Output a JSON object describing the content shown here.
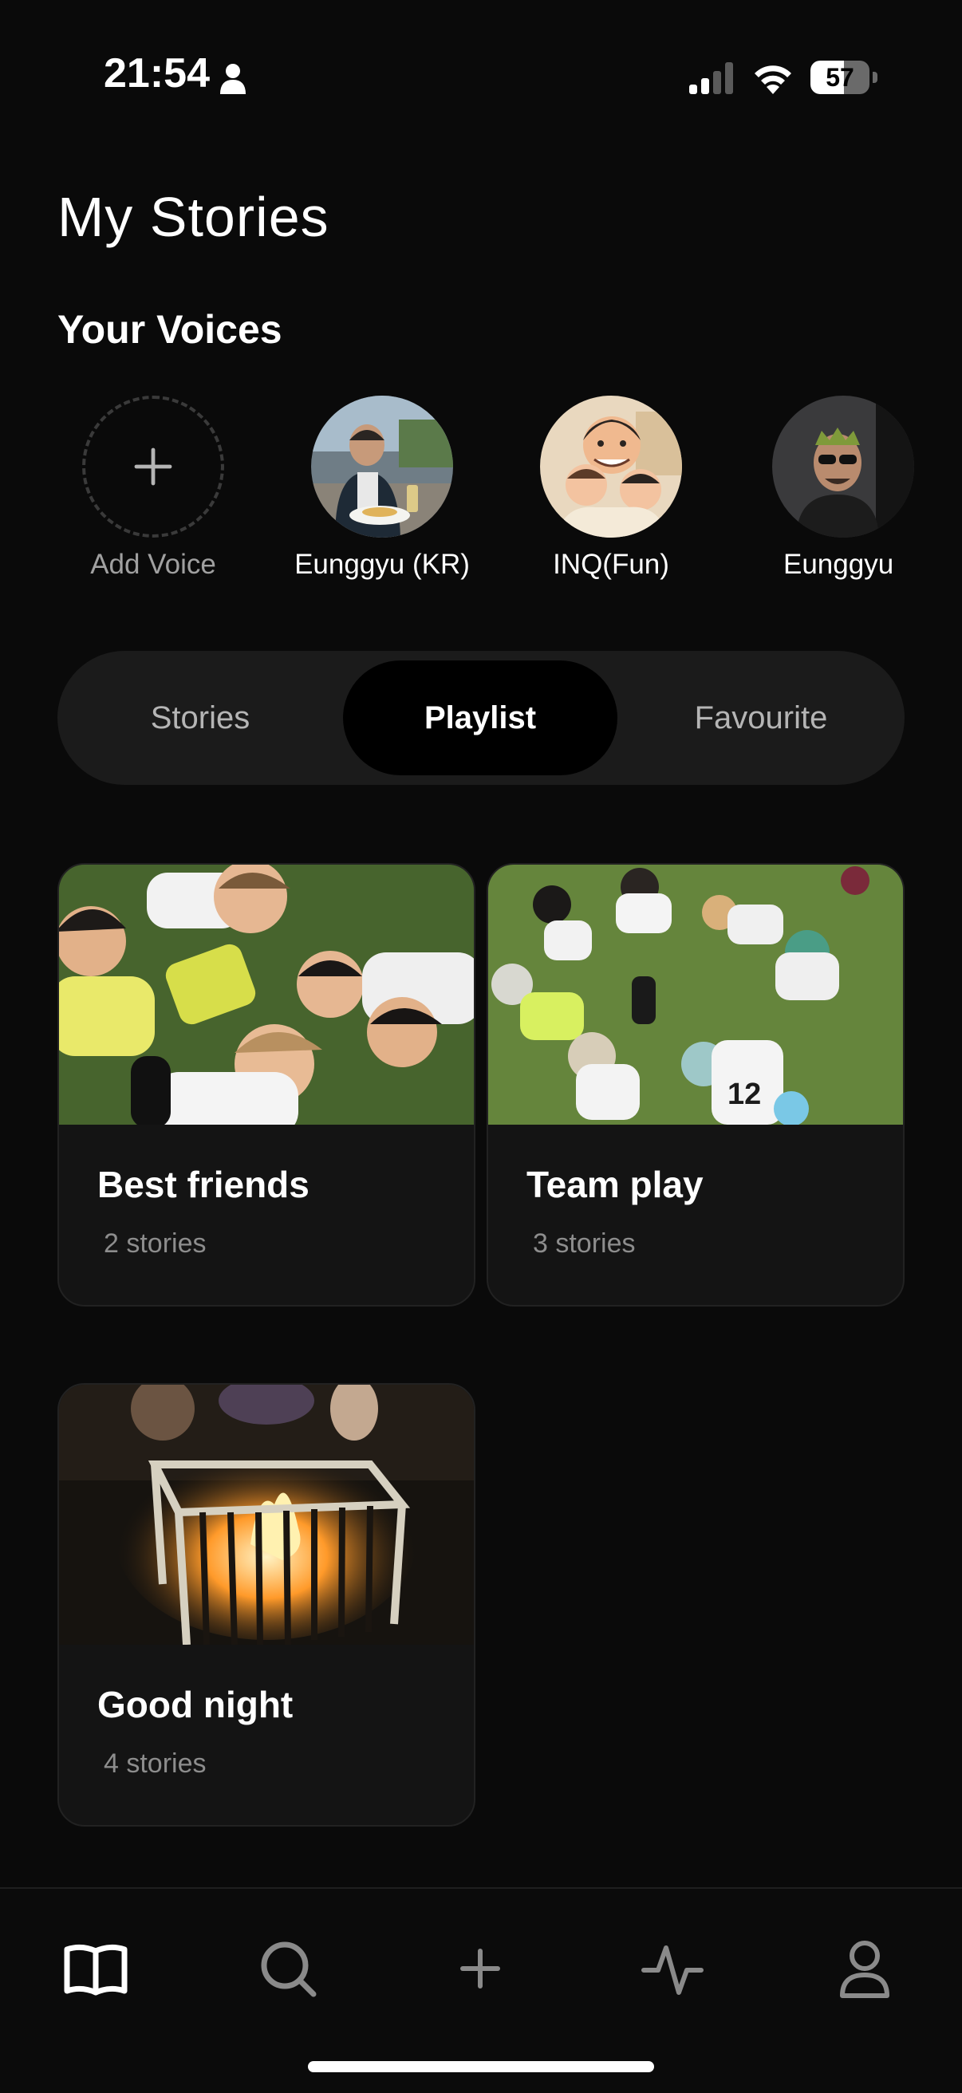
{
  "status_bar": {
    "time": "21:54",
    "battery_percent": 57,
    "battery_label": "57",
    "signal_bars_active": 2,
    "signal_bars_total": 4
  },
  "page": {
    "title": "My Stories"
  },
  "voices_section": {
    "title": "Your Voices",
    "add_label": "Add Voice",
    "voices": [
      {
        "label": "Eunggyu (KR)",
        "avatar": "photo-man-restaurant"
      },
      {
        "label": "INQ(Fun)",
        "avatar": "cartoon-family"
      },
      {
        "label": "Eunggyu",
        "avatar": "photo-man-sunglasses"
      }
    ]
  },
  "tabs": {
    "items": [
      "Stories",
      "Playlist",
      "Favourite"
    ],
    "selected": "Playlist"
  },
  "playlists": [
    {
      "title": "Best friends",
      "count": "2 stories",
      "thumb": "kids-on-grass"
    },
    {
      "title": "Team play",
      "count": "3 stories",
      "thumb": "soccer-team-circle"
    },
    {
      "title": "Good night",
      "count": "4 stories",
      "thumb": "fire-pit-night"
    }
  ],
  "bottom_nav": {
    "items": [
      {
        "icon": "book-icon",
        "active": true
      },
      {
        "icon": "search-icon",
        "active": false
      },
      {
        "icon": "plus-icon",
        "active": false
      },
      {
        "icon": "activity-icon",
        "active": false
      },
      {
        "icon": "profile-icon",
        "active": false
      }
    ]
  },
  "colors": {
    "background": "#0a0a0a",
    "card": "#141414",
    "segment_bg": "#1b1b1b",
    "segment_active": "#000000",
    "muted_text": "#8d8d8d"
  }
}
